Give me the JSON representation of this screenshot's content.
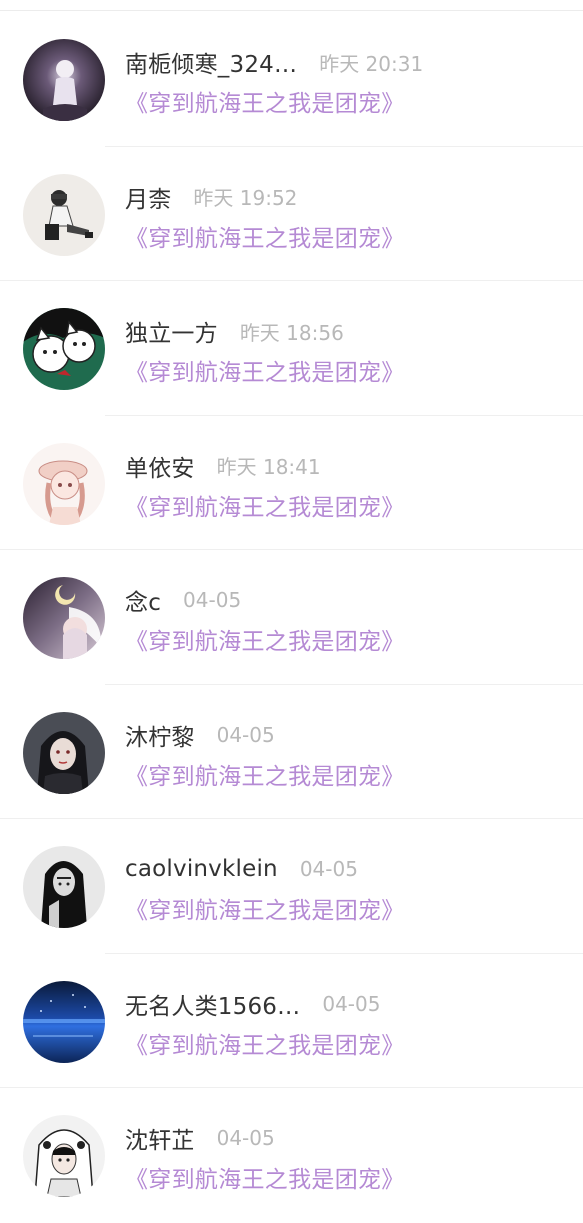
{
  "notifications": [
    {
      "name": "南栀倾寒_324…",
      "time": "昨天 20:31",
      "book": "《穿到航海王之我是团宠》",
      "avatar": "moon-girl-avatar"
    },
    {
      "name": "月柰",
      "time": "昨天 19:52",
      "book": "《穿到航海王之我是团宠》",
      "avatar": "sitting-boy-avatar"
    },
    {
      "name": "独立一方",
      "time": "昨天 18:56",
      "book": "《穿到航海王之我是团宠》",
      "avatar": "cat-avatar"
    },
    {
      "name": "单依安",
      "time": "昨天 18:41",
      "book": "《穿到航海王之我是团宠》",
      "avatar": "anime-girl-avatar"
    },
    {
      "name": "念c",
      "time": "04-05",
      "book": "《穿到航海王之我是团宠》",
      "avatar": "angel-avatar"
    },
    {
      "name": "沐柠黎",
      "time": "04-05",
      "book": "《穿到航海王之我是团宠》",
      "avatar": "dark-hair-girl-avatar"
    },
    {
      "name": "caolvinvklein",
      "time": "04-05",
      "book": "《穿到航海王之我是团宠》",
      "avatar": "bw-girl-avatar"
    },
    {
      "name": "无名人类1566…",
      "time": "04-05",
      "book": "《穿到航海王之我是团宠》",
      "avatar": "blue-night-avatar"
    },
    {
      "name": "沈轩芷",
      "time": "04-05",
      "book": "《穿到航海王之我是团宠》",
      "avatar": "hooded-girl-avatar"
    }
  ],
  "colors": {
    "name": "#333333",
    "time": "#b8b8b8",
    "book": "#b58ad4",
    "divider": "#efefef"
  }
}
